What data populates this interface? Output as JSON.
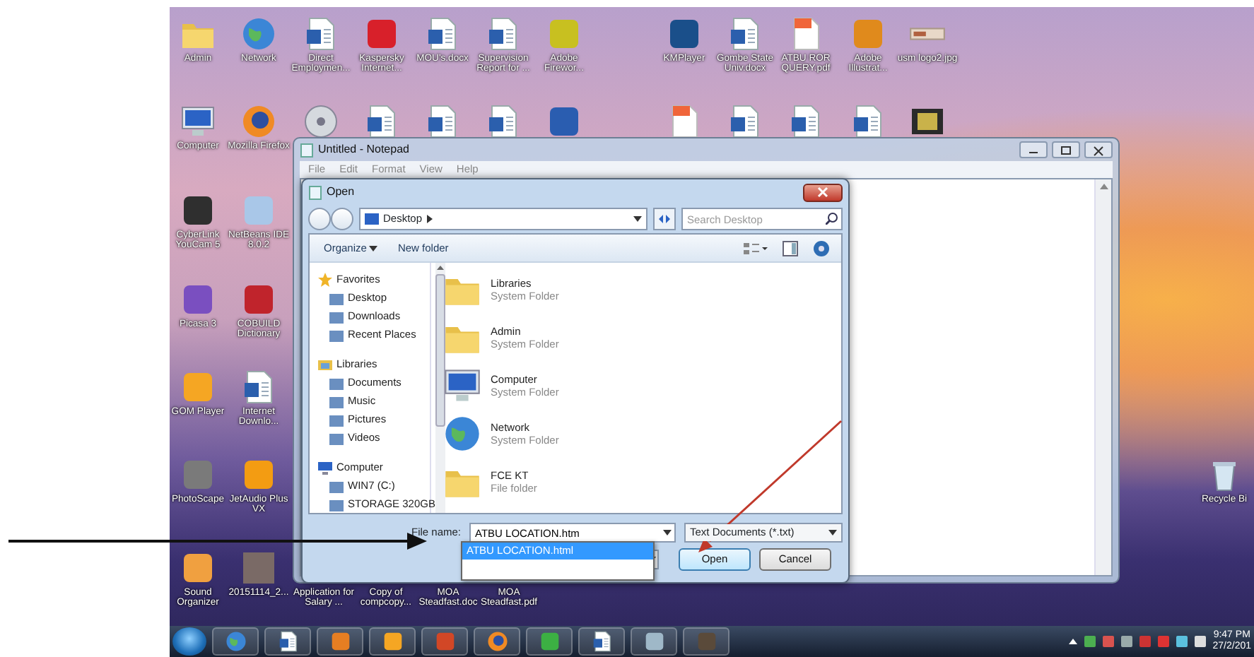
{
  "desktop_icons": [
    {
      "label": "Admin",
      "kind": "folder"
    },
    {
      "label": "Network",
      "kind": "globe"
    },
    {
      "label": "Direct Employmen...",
      "kind": "document"
    },
    {
      "label": "Kaspersky Internet...",
      "kind": "app",
      "color": "#d8202a"
    },
    {
      "label": "MOU's.docx",
      "kind": "document"
    },
    {
      "label": "Supervision Report for ...",
      "kind": "document"
    },
    {
      "label": "Adobe Firewor...",
      "kind": "app",
      "color": "#c8c020"
    },
    {
      "label": "KMPlayer",
      "kind": "app",
      "color": "#1a4f8a"
    },
    {
      "label": "Gombe State Univ.docx",
      "kind": "document"
    },
    {
      "label": "ATBU ROR QUERY.pdf",
      "kind": "pdf"
    },
    {
      "label": "Adobe Illustrat...",
      "kind": "app",
      "color": "#e08a1c"
    },
    {
      "label": "usm logo2.jpg",
      "kind": "image"
    },
    {
      "label": "Computer",
      "kind": "computer"
    },
    {
      "label": "Mozilla Firefox",
      "kind": "browser"
    },
    {
      "kind": "disc"
    },
    {
      "kind": "document"
    },
    {
      "kind": "document"
    },
    {
      "kind": "document"
    },
    {
      "kind": "app",
      "color": "#2a5db0"
    },
    {
      "kind": "pdf"
    },
    {
      "kind": "document"
    },
    {
      "kind": "document"
    },
    {
      "kind": "document"
    },
    {
      "kind": "film"
    },
    {
      "label": "CyberLink YouCam 5",
      "kind": "app",
      "color": "#2f2f2f"
    },
    {
      "label": "NetBeans IDE 8.0.2",
      "kind": "app",
      "color": "#a9c7e8"
    },
    {
      "label": "Picasa 3",
      "kind": "app",
      "color": "#7a4fc0"
    },
    {
      "label": "COBUILD Dictionary",
      "kind": "app",
      "color": "#c0242c"
    },
    {
      "label": "GOM Player",
      "kind": "app",
      "color": "#f5a623"
    },
    {
      "label": "Internet Downlo...",
      "kind": "document"
    },
    {
      "label": "PhotoScape",
      "kind": "app",
      "color": "#7a7a7a"
    },
    {
      "label": "JetAudio Plus VX",
      "kind": "app",
      "color": "#f39c12"
    },
    {
      "label": "Recycle Bi",
      "kind": "recycle"
    },
    {
      "label": "Sound Organizer",
      "kind": "app",
      "color": "#f0a040"
    },
    {
      "label": "20151114_2...",
      "kind": "photo"
    },
    {
      "label": "Application for Salary ..."
    },
    {
      "label": "Copy of compcopy..."
    },
    {
      "label": "MOA Steadfast.doc"
    },
    {
      "label": "MOA Steadfast.pdf"
    }
  ],
  "notepad": {
    "title": "Untitled - Notepad",
    "menu": [
      "File",
      "Edit",
      "Format",
      "View",
      "Help"
    ]
  },
  "dialog": {
    "title": "Open",
    "address": "Desktop",
    "search_placeholder": "Search Desktop",
    "toolbar": [
      "Organize",
      "New folder"
    ],
    "nav": [
      {
        "label": "Favorites",
        "children": [
          {
            "label": "Desktop"
          },
          {
            "label": "Downloads"
          },
          {
            "label": "Recent Places"
          }
        ]
      },
      {
        "label": "Libraries",
        "children": [
          {
            "label": "Documents"
          },
          {
            "label": "Music"
          },
          {
            "label": "Pictures"
          },
          {
            "label": "Videos"
          }
        ]
      },
      {
        "label": "Computer",
        "children": [
          {
            "label": "WIN7 (C:)"
          },
          {
            "label": "STORAGE 320GB"
          }
        ]
      }
    ],
    "files": [
      {
        "name": "Libraries",
        "type": "System Folder",
        "kind": "folder"
      },
      {
        "name": "Admin",
        "type": "System Folder",
        "kind": "folder"
      },
      {
        "name": "Computer",
        "type": "System Folder",
        "kind": "computer"
      },
      {
        "name": "Network",
        "type": "System Folder",
        "kind": "globe"
      },
      {
        "name": "FCE KT",
        "type": "File folder",
        "kind": "folder"
      }
    ],
    "file_name_label": "File name:",
    "file_name": "ATBU LOCATION.htm",
    "suggestions": [
      {
        "text": "ATBU LOCATION.html",
        "selected": true
      }
    ],
    "file_type": "Text Documents (*.txt)",
    "buttons": [
      {
        "label": "Open",
        "default": true
      },
      {
        "label": "Cancel",
        "default": false
      }
    ]
  },
  "taskbar": {
    "apps": [
      {
        "kind": "globe"
      },
      {
        "kind": "document"
      },
      {
        "kind": "app",
        "color": "#e67e22"
      },
      {
        "kind": "app",
        "color": "#f5a623"
      },
      {
        "kind": "app",
        "color": "#d24726"
      },
      {
        "kind": "browser"
      },
      {
        "kind": "app",
        "color": "#3cb043"
      },
      {
        "kind": "document"
      },
      {
        "kind": "app",
        "color": "#9fb8c8"
      },
      {
        "kind": "app",
        "color": "#5a4a3a"
      }
    ],
    "time": "9:47 PM",
    "date": "27/2/201"
  }
}
